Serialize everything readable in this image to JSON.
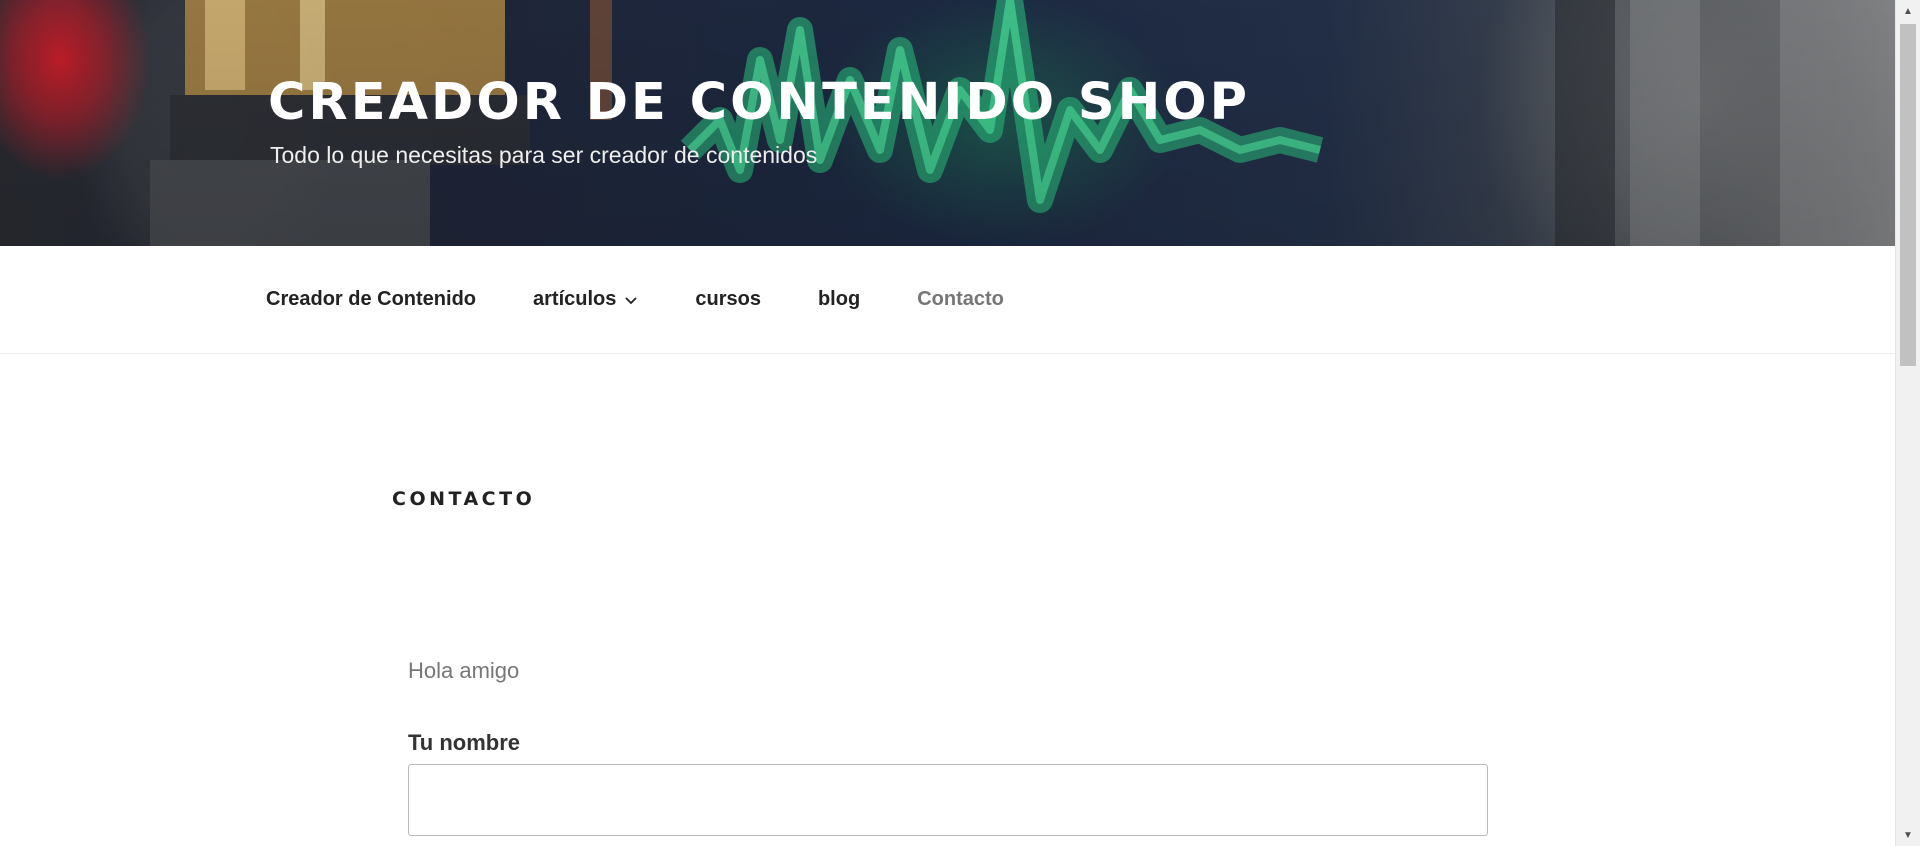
{
  "header": {
    "site_title": "CREADOR DE CONTENIDO SHOP",
    "site_description": "Todo lo que necesitas para ser creador de contenidos"
  },
  "nav": {
    "items": [
      {
        "label": "Creador de Contenido",
        "current": false,
        "has_dropdown": false
      },
      {
        "label": "artículos",
        "current": false,
        "has_dropdown": true
      },
      {
        "label": "cursos",
        "current": false,
        "has_dropdown": false
      },
      {
        "label": "blog",
        "current": false,
        "has_dropdown": false
      },
      {
        "label": "Contacto",
        "current": true,
        "has_dropdown": false
      }
    ]
  },
  "content": {
    "page_title": "CONTACTO",
    "intro": "Hola amigo",
    "form": {
      "name_label": "Tu nombre",
      "name_value": ""
    }
  },
  "colors": {
    "nav_text": "#222222",
    "nav_current": "#767676",
    "title_text": "#ffffff"
  },
  "icons": {
    "dropdown": "chevron-down-icon",
    "scroll_up": "scroll-up-arrow-icon",
    "scroll_down": "scroll-down-arrow-icon"
  }
}
